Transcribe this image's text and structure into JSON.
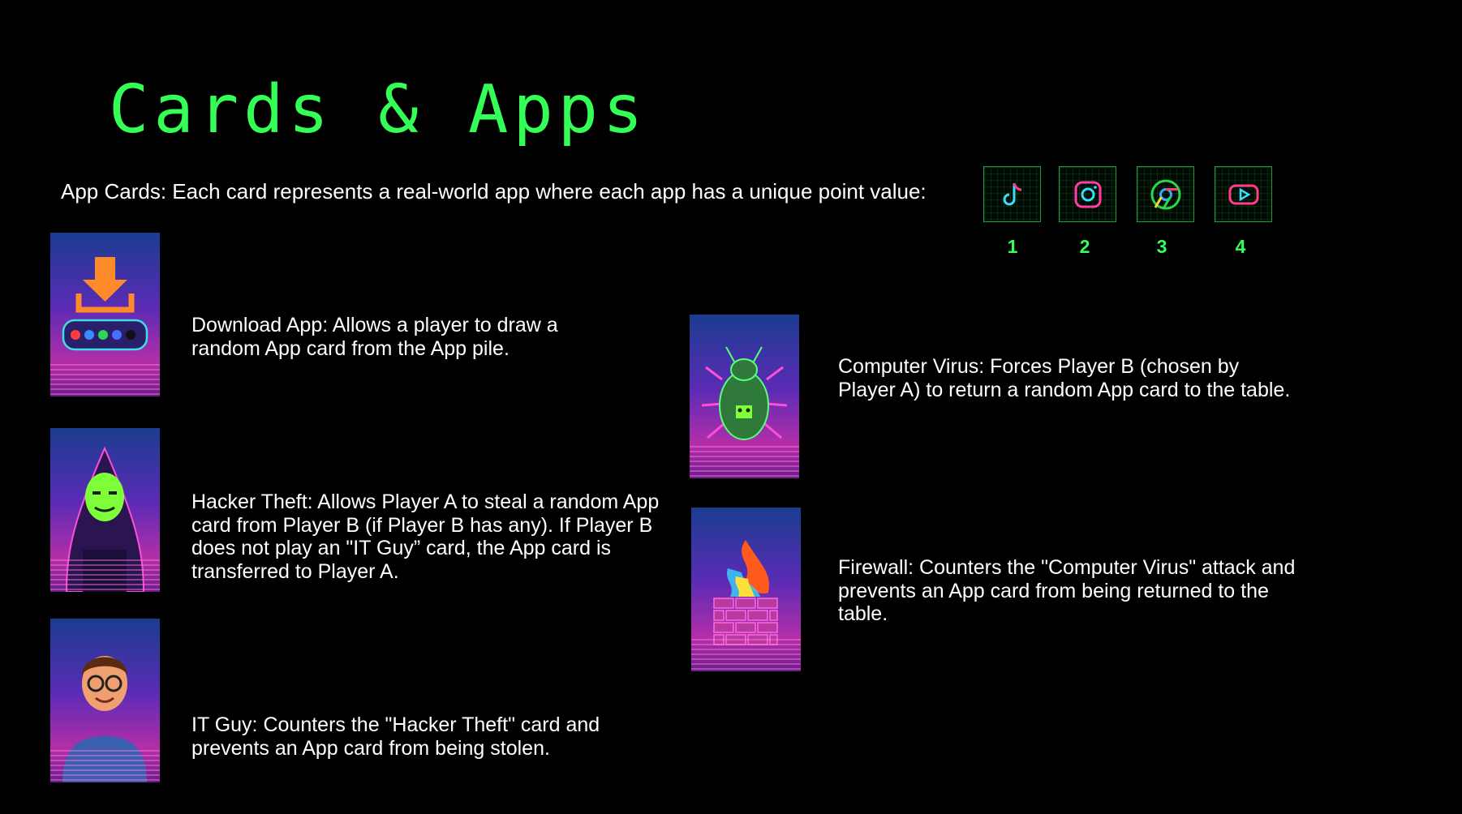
{
  "title": "Cards & Apps",
  "intro": "App Cards: Each card represents a real-world app where each app has a unique point value:",
  "apps": [
    {
      "icon": "tiktok-icon",
      "value": "1"
    },
    {
      "icon": "instagram-icon",
      "value": "2"
    },
    {
      "icon": "chrome-icon",
      "value": "3"
    },
    {
      "icon": "youtube-icon",
      "value": "4"
    }
  ],
  "cards": {
    "download": "Download App: Allows a player to draw a random App card from the App pile.",
    "hacker": "Hacker Theft: Allows Player A to steal a random App card from Player B (if Player B has any). If Player B does not play an \"IT Guy” card, the App card is transferred to Player A.",
    "itguy": "IT Guy: Counters the \"Hacker Theft\" card and prevents an App card from being stolen.",
    "virus": "Computer Virus: Forces Player B (chosen by Player A) to return a random App card to the table.",
    "firewall": "Firewall: Counters the \"Computer Virus\" attack and prevents an App card from being returned to the table."
  },
  "colors": {
    "accent": "#34ff57",
    "background": "#000000"
  }
}
